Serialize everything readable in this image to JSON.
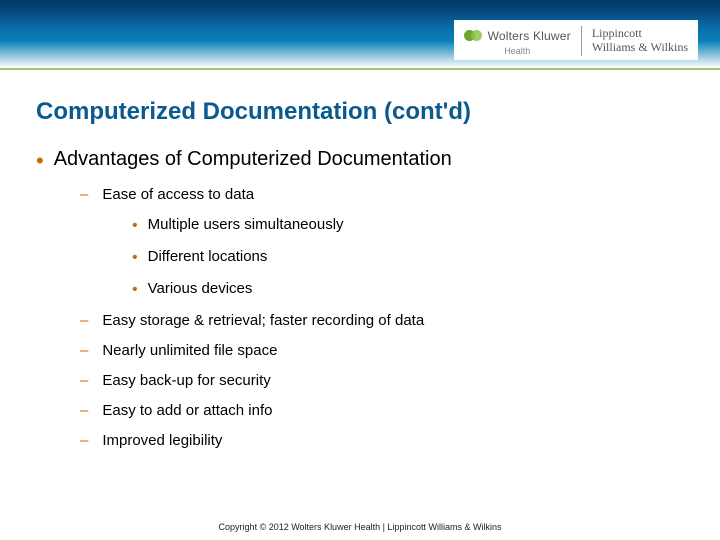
{
  "brand": {
    "wk_name": "Wolters Kluwer",
    "wk_sub": "Health",
    "lww_line1": "Lippincott",
    "lww_line2": "Williams & Wilkins"
  },
  "title": "Computerized Documentation (cont'd)",
  "bullet_main": "Advantages of Computerized Documentation",
  "sub": {
    "a": "Ease of access to data",
    "a1": "Multiple users simultaneously",
    "a2": "Different locations",
    "a3": "Various devices",
    "b": "Easy storage & retrieval; faster recording of data",
    "c": "Nearly unlimited file space",
    "d": "Easy back-up for security",
    "e": "Easy to add or attach info",
    "f": "Improved legibility"
  },
  "footer": "Copyright © 2012 Wolters Kluwer Health | Lippincott Williams & Wilkins"
}
